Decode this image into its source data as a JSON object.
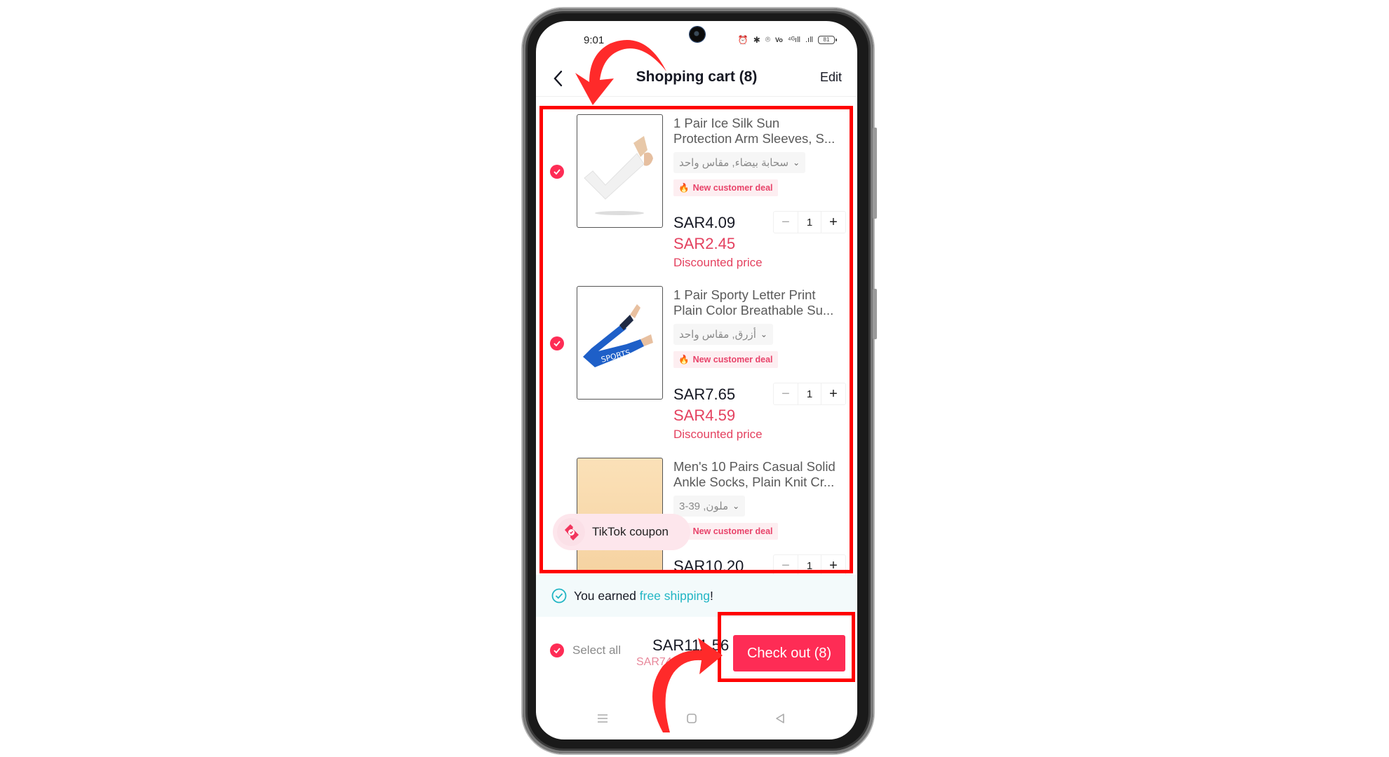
{
  "status_bar": {
    "time": "9:01",
    "icons": [
      "alarm-icon",
      "bluetooth-icon",
      "location-icon",
      "volte-icon",
      "signal-4g-icon",
      "signal-icon"
    ],
    "battery": "81"
  },
  "header": {
    "title": "Shopping cart (8)",
    "edit_label": "Edit"
  },
  "cart": {
    "items": [
      {
        "title_line1": "1 Pair Ice Silk Sun",
        "title_line2": "Protection Arm Sleeves, S...",
        "variant": "سحابة بيضاء, مقاس واحد",
        "badge": "New customer deal",
        "price": "SAR4.09",
        "discounted_price": "SAR2.45",
        "discount_label": "Discounted price",
        "quantity": "1",
        "selected": true
      },
      {
        "title_line1": "1 Pair Sporty Letter Print",
        "title_line2": "Plain Color Breathable Su...",
        "variant": "أزرق, مقاس واحد",
        "badge": "New customer deal",
        "price": "SAR7.65",
        "discounted_price": "SAR4.59",
        "discount_label": "Discounted price",
        "quantity": "1",
        "selected": true
      },
      {
        "title_line1": "Men's 10 Pairs Casual Solid",
        "title_line2": "Ankle Socks, Plain Knit Cr...",
        "variant": "ملون, 39-3",
        "badge": "New customer deal",
        "price": "SAR10.20",
        "quantity": "1"
      }
    ]
  },
  "coupon": {
    "label": "TikTok coupon"
  },
  "shipping": {
    "prefix": "You earned ",
    "highlight": "free shipping",
    "suffix": "!"
  },
  "footer": {
    "select_all_label": "Select all",
    "total": "SAR111.56",
    "subtotal": "SAR74.",
    "checkout_label": "Check out (8)"
  },
  "colors": {
    "accent": "#fe2c55",
    "discount": "#e4415f",
    "shipping_highlight": "#21b5c4",
    "annotation": "#ff0000"
  }
}
